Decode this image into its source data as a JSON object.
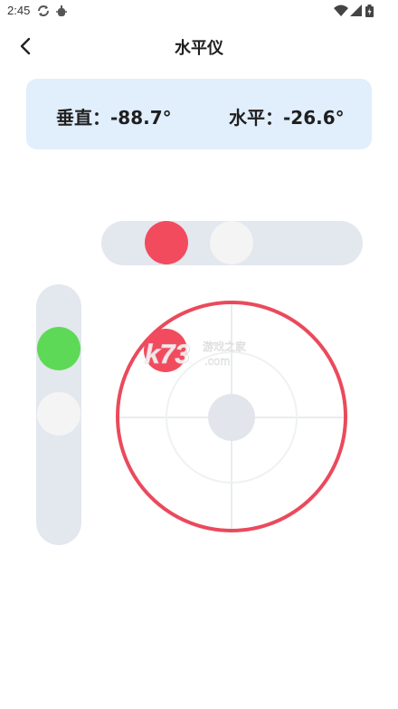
{
  "status_bar": {
    "time": "2:45",
    "icons": [
      "sync-icon",
      "debug-icon",
      "wifi-icon",
      "cell-signal-icon",
      "battery-icon"
    ]
  },
  "header": {
    "title": "水平仪",
    "back_icon": "chevron-left-icon"
  },
  "readout": {
    "vertical_label": "垂直：",
    "vertical_value": "-88.7°",
    "horizontal_label": "水平：",
    "horizontal_value": "-26.6°"
  },
  "watermark": {
    "logo_text": "k73",
    "site_text": "游戏之家",
    "domain_text": ".com"
  },
  "colors": {
    "accent_red": "#f24b5e",
    "ring_red": "#ea4a5c",
    "green": "#5ed957",
    "track_gray": "#e3e7ee",
    "card_bg": "#e1eefc",
    "neutral_dot": "#f4f4f4",
    "center_dot": "#e2e6ec",
    "crosshair": "#e8ecef"
  }
}
